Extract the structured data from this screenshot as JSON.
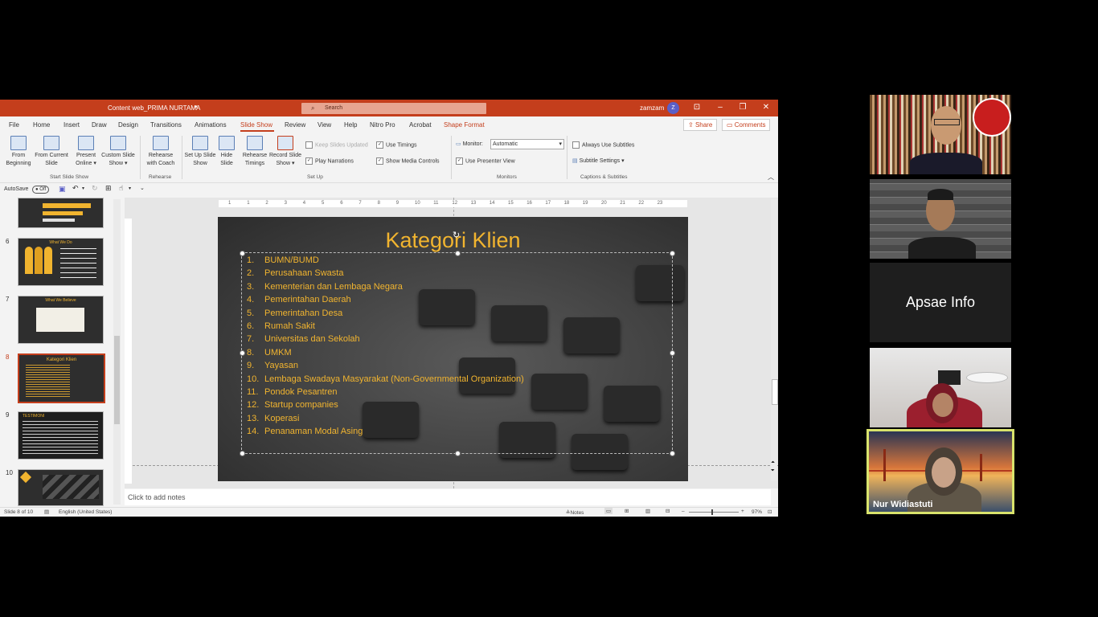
{
  "app": {
    "doc_title": "Content web_PRIMA NURTAMA",
    "search_placeholder": "Search",
    "user": "zamzam",
    "avatar_initial": "Z"
  },
  "menu": {
    "items": [
      "File",
      "Home",
      "Insert",
      "Draw",
      "Design",
      "Transitions",
      "Animations",
      "Slide Show",
      "Review",
      "View",
      "Help",
      "Nitro Pro",
      "Acrobat",
      "Shape Format"
    ],
    "share": "Share",
    "comments": "Comments"
  },
  "ribbon": {
    "from_beginning": "From Beginning",
    "from_current": "From Current Slide",
    "present_online": "Present Online",
    "custom_show": "Custom Slide Show",
    "group_start": "Start Slide Show",
    "rehearse_coach": "Rehearse with Coach",
    "group_rehearse": "Rehearse",
    "setup_show": "Set Up Slide Show",
    "hide_slide": "Hide Slide",
    "rehearse_timings": "Rehearse Timings",
    "record_show": "Record Slide Show",
    "keep_updated": "Keep Slides Updated",
    "play_narrations": "Play Narrations",
    "use_timings": "Use Timings",
    "show_media": "Show Media Controls",
    "group_setup": "Set Up",
    "monitor_label": "Monitor:",
    "monitor_value": "Automatic",
    "presenter_view": "Use Presenter View",
    "group_monitors": "Monitors",
    "always_subtitles": "Always Use Subtitles",
    "subtitle_settings": "Subtitle Settings",
    "group_captions": "Captions & Subtitles"
  },
  "qat": {
    "autosave": "AutoSave",
    "toggle": "Off"
  },
  "thumbnails": [
    {
      "num": "",
      "title": ""
    },
    {
      "num": "6",
      "title": "What We Do"
    },
    {
      "num": "7",
      "title": "What We Believe"
    },
    {
      "num": "8",
      "title": "Kategori Klien"
    },
    {
      "num": "9",
      "title": "TESTIMONI"
    },
    {
      "num": "10",
      "title": ""
    }
  ],
  "ruler": [
    "1",
    "1",
    "2",
    "3",
    "4",
    "5",
    "6",
    "7",
    "8",
    "9",
    "10",
    "11",
    "12",
    "13",
    "14",
    "15",
    "16",
    "17",
    "18",
    "19",
    "20",
    "21",
    "22",
    "23"
  ],
  "slide": {
    "title": "Kategori Klien",
    "items": [
      "BUMN/BUMD",
      "Perusahaan Swasta",
      "Kementerian dan Lembaga Negara",
      "Pemerintahan Daerah",
      "Pemerintahan Desa",
      "Rumah Sakit",
      "Universitas dan Sekolah",
      "UMKM",
      "Yayasan",
      "Lembaga Swadaya Masyarakat (Non-Governmental Organization)",
      "Pondok Pesantren",
      "Startup companies",
      "Koperasi",
      "Penanaman Modal Asing"
    ]
  },
  "notes_placeholder": "Click to add notes",
  "status": {
    "slide_info": "Slide 8 of 10",
    "language": "English (United States)",
    "notes": "Notes",
    "zoom": "97%"
  },
  "participants": {
    "tile3_name": "Apsae Info",
    "tile5_name": "Nur Widiastuti"
  },
  "colors": {
    "accent": "#c43e1c",
    "slide_text": "#f1b42f",
    "active_speaker": "#d9e36c"
  }
}
